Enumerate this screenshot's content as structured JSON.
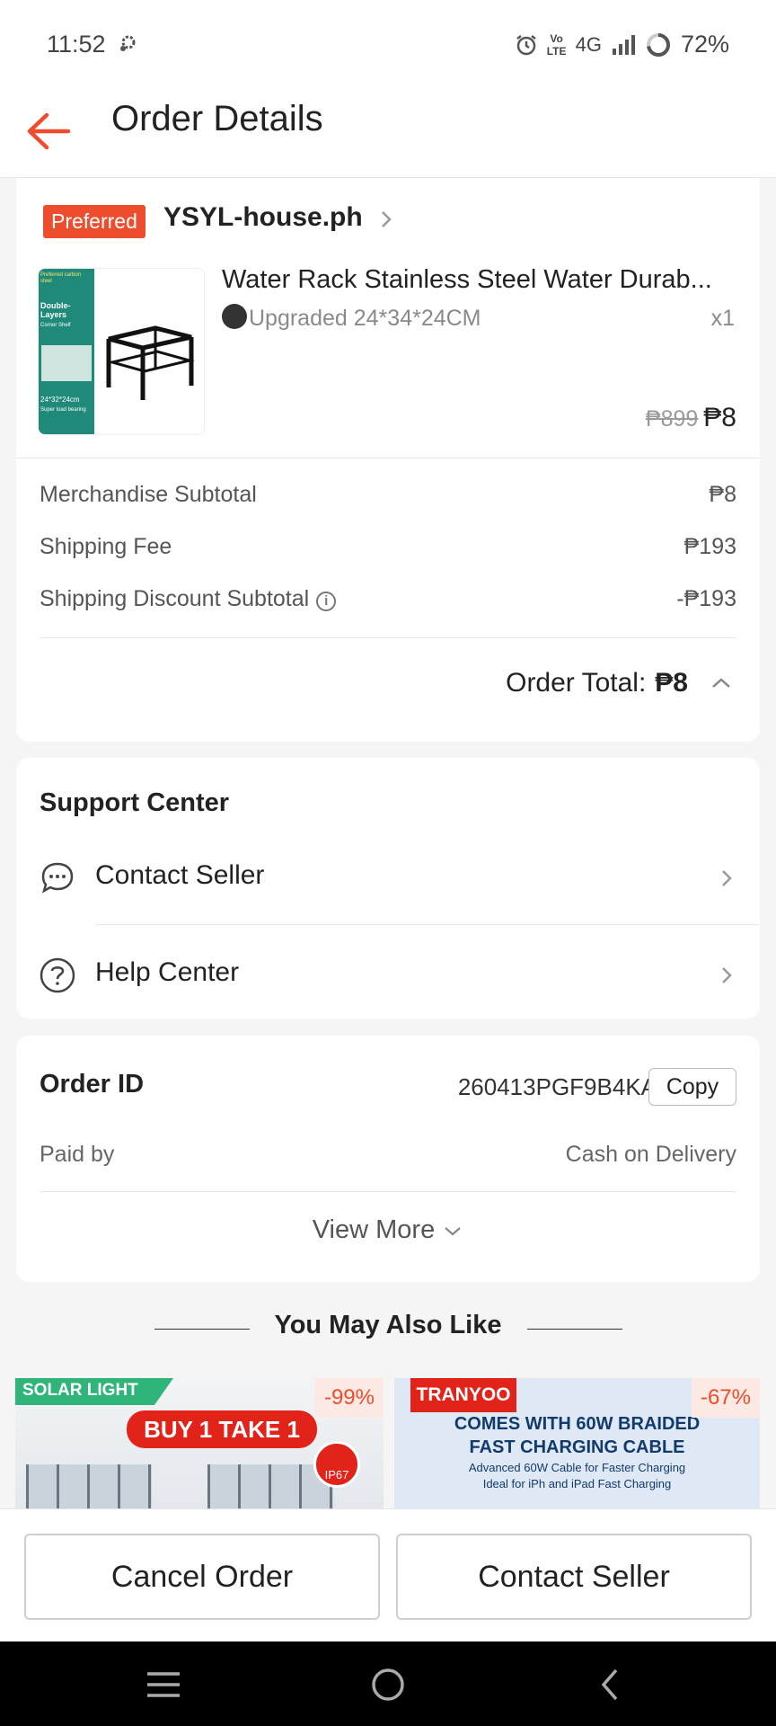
{
  "status_bar": {
    "time": "11:52",
    "network": "4G",
    "volte": "Vo LTE",
    "battery": "72%"
  },
  "header": {
    "title": "Order Details"
  },
  "shop": {
    "badge": "Preferred",
    "name": "YSYL-house.ph",
    "product": {
      "title": "Water Rack Stainless Steel Water Durab...",
      "variant": "Upgraded 24*34*24CM",
      "quantity": "x1",
      "price_original": "₱899",
      "price_current": "₱8",
      "image_text": {
        "top": "Preferred carbon steel",
        "main": "Double-Layers",
        "sub": "Corner Shelf",
        "size": "24*32*24cm",
        "bottom": "Super load bearing"
      }
    },
    "fees": [
      {
        "label": "Merchandise Subtotal",
        "value": "₱8"
      },
      {
        "label": "Shipping Fee",
        "value": "₱193"
      },
      {
        "label": "Shipping Discount Subtotal",
        "value": "-₱193"
      }
    ],
    "order_total_label": "Order Total:",
    "order_total_value": "₱8"
  },
  "support": {
    "title": "Support Center",
    "items": [
      {
        "label": "Contact Seller"
      },
      {
        "label": "Help Center"
      }
    ]
  },
  "order_info": {
    "id_label": "Order ID",
    "id_value": "260413PGF9B4KA",
    "copy_label": "Copy",
    "paid_label": "Paid by",
    "paid_value": "Cash on Delivery",
    "view_more": "View More"
  },
  "recommendations": {
    "title": "You May Also Like",
    "items": [
      {
        "tag": "SOLAR LIGHT",
        "headline": "BUY 1 TAKE 1",
        "rating": "IP67",
        "discount": "-99%"
      },
      {
        "brand": "TRANYOO",
        "headline1": "COMES WITH 60W BRAIDED",
        "headline2": "FAST CHARGING CABLE",
        "sub1": "Advanced 60W Cable for Faster Charging",
        "sub2": "Ideal for iPh and iPad Fast Charging",
        "discount": "-67%"
      }
    ]
  },
  "actions": {
    "cancel": "Cancel Order",
    "contact": "Contact Seller"
  },
  "colors": {
    "accent": "#ee4d2d",
    "background": "#f5f5f5"
  }
}
